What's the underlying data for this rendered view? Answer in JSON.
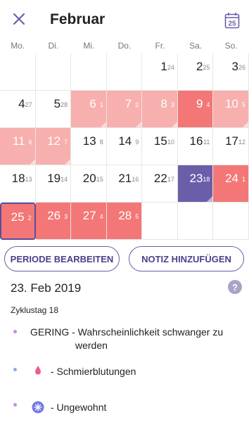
{
  "header": {
    "title": "Februar",
    "calendar_day": "25"
  },
  "weekdays": [
    "Mo.",
    "Di.",
    "Mi.",
    "Do.",
    "Fr.",
    "Sa.",
    "So."
  ],
  "cells": [
    {
      "day": "",
      "cyc": "",
      "style": "empty"
    },
    {
      "day": "",
      "cyc": "",
      "style": "empty"
    },
    {
      "day": "",
      "cyc": "",
      "style": "empty"
    },
    {
      "day": "",
      "cyc": "",
      "style": "empty"
    },
    {
      "day": "1",
      "cyc": "24",
      "style": "normal"
    },
    {
      "day": "2",
      "cyc": "25",
      "style": "normal"
    },
    {
      "day": "3",
      "cyc": "26",
      "style": "normal"
    },
    {
      "day": "4",
      "cyc": "27",
      "style": "normal"
    },
    {
      "day": "5",
      "cyc": "28",
      "style": "normal"
    },
    {
      "day": "6",
      "cyc": "1",
      "style": "light"
    },
    {
      "day": "7",
      "cyc": "2",
      "style": "light"
    },
    {
      "day": "8",
      "cyc": "3",
      "style": "light"
    },
    {
      "day": "9",
      "cyc": "4",
      "style": "strong"
    },
    {
      "day": "10",
      "cyc": "5",
      "style": "light"
    },
    {
      "day": "11",
      "cyc": "6",
      "style": "light"
    },
    {
      "day": "12",
      "cyc": "7",
      "style": "light"
    },
    {
      "day": "13",
      "cyc": "8",
      "style": "normal"
    },
    {
      "day": "14",
      "cyc": "9",
      "style": "normal"
    },
    {
      "day": "15",
      "cyc": "10",
      "style": "normal"
    },
    {
      "day": "16",
      "cyc": "11",
      "style": "normal"
    },
    {
      "day": "17",
      "cyc": "12",
      "style": "normal"
    },
    {
      "day": "18",
      "cyc": "13",
      "style": "normal"
    },
    {
      "day": "19",
      "cyc": "14",
      "style": "normal"
    },
    {
      "day": "20",
      "cyc": "15",
      "style": "normal"
    },
    {
      "day": "21",
      "cyc": "16",
      "style": "normal"
    },
    {
      "day": "22",
      "cyc": "17",
      "style": "normal"
    },
    {
      "day": "23",
      "cyc": "18",
      "style": "purple"
    },
    {
      "day": "24",
      "cyc": "1",
      "style": "strong"
    },
    {
      "day": "25",
      "cyc": "2",
      "style": "strong-today"
    },
    {
      "day": "26",
      "cyc": "3",
      "style": "strong"
    },
    {
      "day": "27",
      "cyc": "4",
      "style": "strong"
    },
    {
      "day": "28",
      "cyc": "5",
      "style": "strong"
    },
    {
      "day": "",
      "cyc": "",
      "style": "empty"
    },
    {
      "day": "",
      "cyc": "",
      "style": "empty"
    },
    {
      "day": "",
      "cyc": "",
      "style": "empty"
    }
  ],
  "actions": {
    "edit_period": "PERIODE BEARBEITEN",
    "add_note": "NOTIZ HINZUFÜGEN"
  },
  "detail": {
    "date": "23. Feb 2019",
    "help": "?",
    "cycle_day": "Zyklustag 18",
    "entries": [
      {
        "text": "GERING - Wahrscheinlichkeit schwanger zu",
        "text2": "werden",
        "dot_color": "#c88be0",
        "icon": "none"
      },
      {
        "text": "-  Schmierblutungen",
        "dot_color": "#8fa9e8",
        "icon": "drop-icon"
      },
      {
        "text": "-  Ungewohnt",
        "dot_color": "#c88be0",
        "icon": "sparkle-icon"
      }
    ]
  },
  "colors": {
    "accent": "#6b5ea8",
    "period_light": "#f7b0ad",
    "period_strong": "#f37776",
    "fertile_day": "#6b5ea8"
  }
}
